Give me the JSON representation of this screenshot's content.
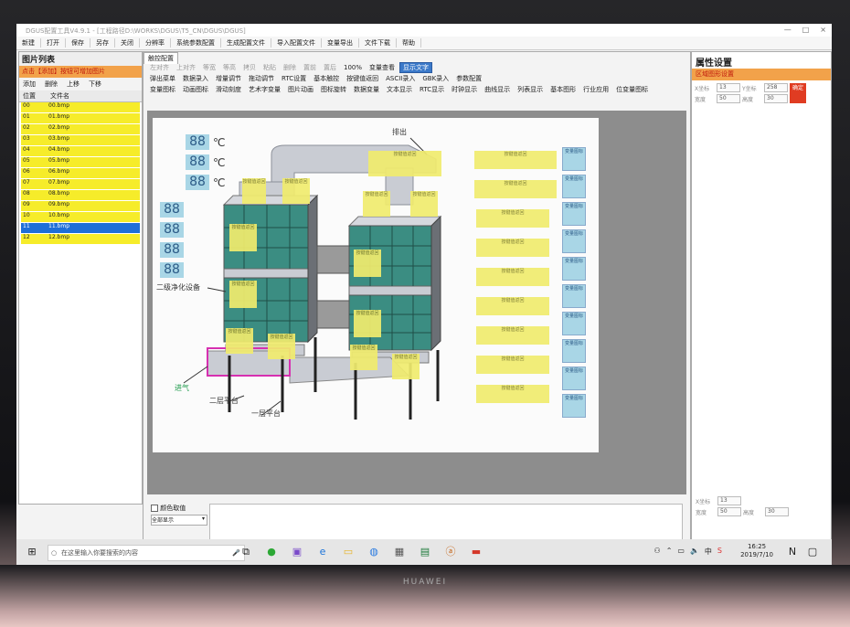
{
  "window": {
    "title": "DGUS配置工具V4.9.1 - [工程路径D:\\WORKS\\DGUS\\T5_CN\\DGUS\\DGUS]",
    "controls": [
      "—",
      "□",
      "×"
    ]
  },
  "menu": [
    "新建",
    "打开",
    "保存",
    "另存",
    "关闭",
    "分辨率",
    "系统参数配置",
    "生成配置文件",
    "导入配置文件",
    "变量导出",
    "文件下载",
    "帮助"
  ],
  "left": {
    "title": "图片列表",
    "hint": "点击【添加】按钮可增加图片",
    "buttons": [
      "添加",
      "删除",
      "上移",
      "下移"
    ],
    "headers": [
      "位置",
      "文件名"
    ],
    "rows": [
      {
        "pos": "00",
        "file": "00.bmp"
      },
      {
        "pos": "01",
        "file": "01.bmp"
      },
      {
        "pos": "02",
        "file": "02.bmp"
      },
      {
        "pos": "03",
        "file": "03.bmp"
      },
      {
        "pos": "04",
        "file": "04.bmp"
      },
      {
        "pos": "05",
        "file": "05.bmp"
      },
      {
        "pos": "06",
        "file": "06.bmp"
      },
      {
        "pos": "07",
        "file": "07.bmp"
      },
      {
        "pos": "08",
        "file": "08.bmp"
      },
      {
        "pos": "09",
        "file": "09.bmp"
      },
      {
        "pos": "10",
        "file": "10.bmp"
      },
      {
        "pos": "11",
        "file": "11.bmp",
        "selected": true
      },
      {
        "pos": "12",
        "file": "12.bmp"
      }
    ]
  },
  "center": {
    "tab": "触控配置",
    "row1": [
      "左对齐",
      "上对齐",
      "等宽",
      "等高",
      "拷贝",
      "粘贴",
      "删除",
      "置前",
      "置后",
      "100%",
      "变量查看",
      "显示文字"
    ],
    "row2": [
      "弹出菜单",
      "数据录入",
      "增量调节",
      "拖动调节",
      "RTC设置",
      "基本触控",
      "按键值返回",
      "ASCII录入",
      "GBK录入",
      "参数配置"
    ],
    "row3": [
      "变量图标",
      "动画图标",
      "滑动刻度",
      "艺术字变量",
      "图片动画",
      "图标旋转",
      "数据变量",
      "文本显示",
      "RTC显示",
      "时钟显示",
      "曲线显示",
      "列表显示",
      "基本图形",
      "行业应用",
      "位变量图标"
    ],
    "bottom": {
      "checkbox": "颜色取值",
      "select": "全部显示"
    }
  },
  "canvas": {
    "values": [
      "88",
      "88",
      "88",
      "88",
      "88",
      "88",
      "88"
    ],
    "unit": "℃",
    "labels": [
      "排出",
      "二级净化设备",
      "进气",
      "二层平台",
      "一层平台"
    ],
    "ylabel_text": "按键值返回",
    "var_text": "变量图标"
  },
  "right": {
    "title": "属性设置",
    "bar": "区域图形设置",
    "fields": [
      {
        "label": "X坐标",
        "value": "13"
      },
      {
        "label": "Y坐标",
        "value": "258"
      },
      {
        "label": "宽度",
        "value": "50"
      },
      {
        "label": "高度",
        "value": "30"
      }
    ],
    "button": "确定",
    "bottom_fields": [
      {
        "label": "X坐标",
        "value": "13"
      },
      {
        "label": "宽度",
        "value": "50"
      },
      {
        "label": "高度",
        "value": "30"
      }
    ]
  },
  "taskbar": {
    "search": "在这里输入你要搜索的内容",
    "time": "16:25",
    "date": "2019/7/10",
    "lang": "中"
  },
  "brand": "HUAWEI"
}
